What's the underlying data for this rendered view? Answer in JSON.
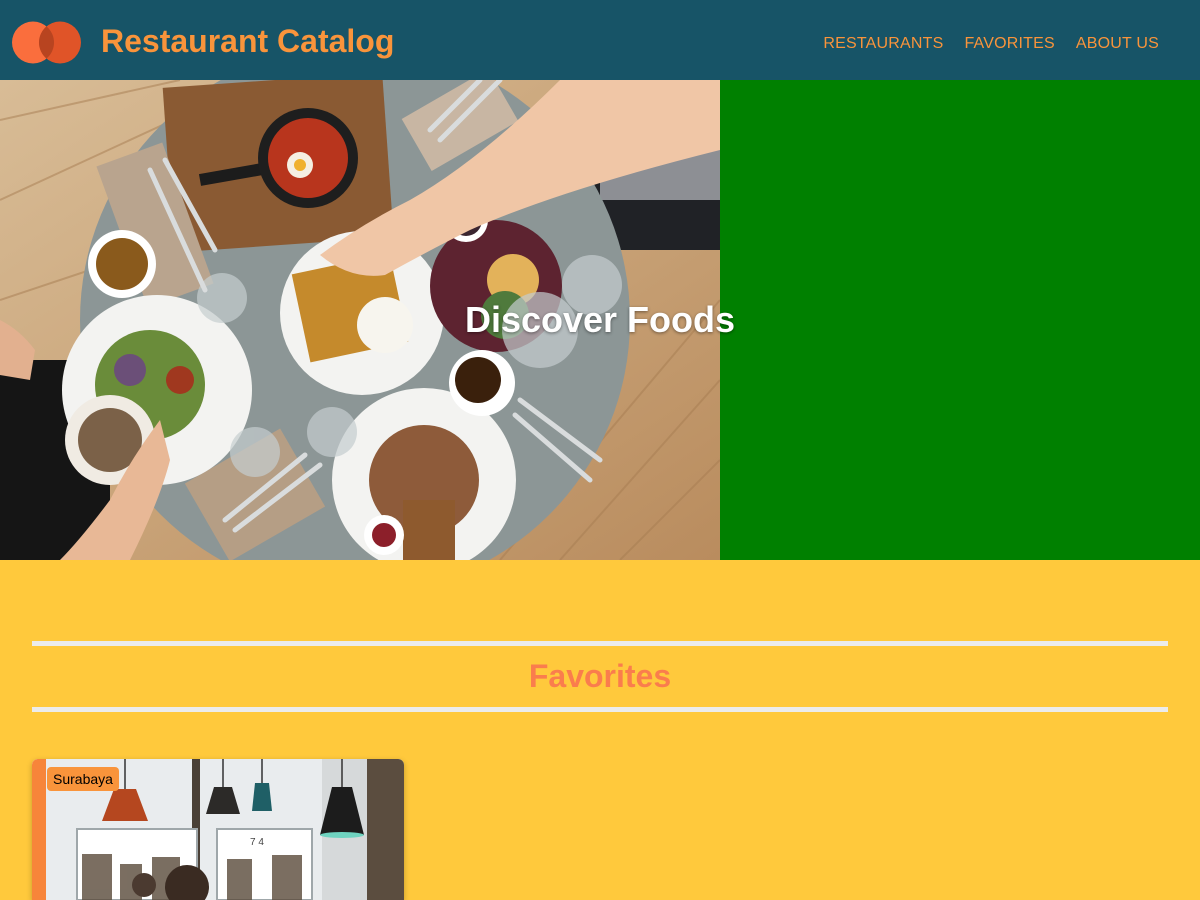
{
  "header": {
    "app_title": "Restaurant Catalog",
    "logo_icon": "twin-circles-logo-icon",
    "nav": [
      {
        "label": "RESTAURANTS"
      },
      {
        "label": "FAVORITES"
      },
      {
        "label": "ABOUT US"
      }
    ],
    "colors": {
      "background": "#175467",
      "accent": "#f9943b"
    }
  },
  "hero": {
    "title": "Discover Foods",
    "image": "breakfast-table-top-view-image",
    "colors": {
      "background": "#008000"
    }
  },
  "favorites": {
    "title": "Favorites",
    "colors": {
      "background": "#ffc93c",
      "title": "#fa7d4d"
    },
    "restaurants": [
      {
        "city": "Surabaya",
        "image": "restaurant-interior-pendant-lamps-image"
      }
    ]
  }
}
